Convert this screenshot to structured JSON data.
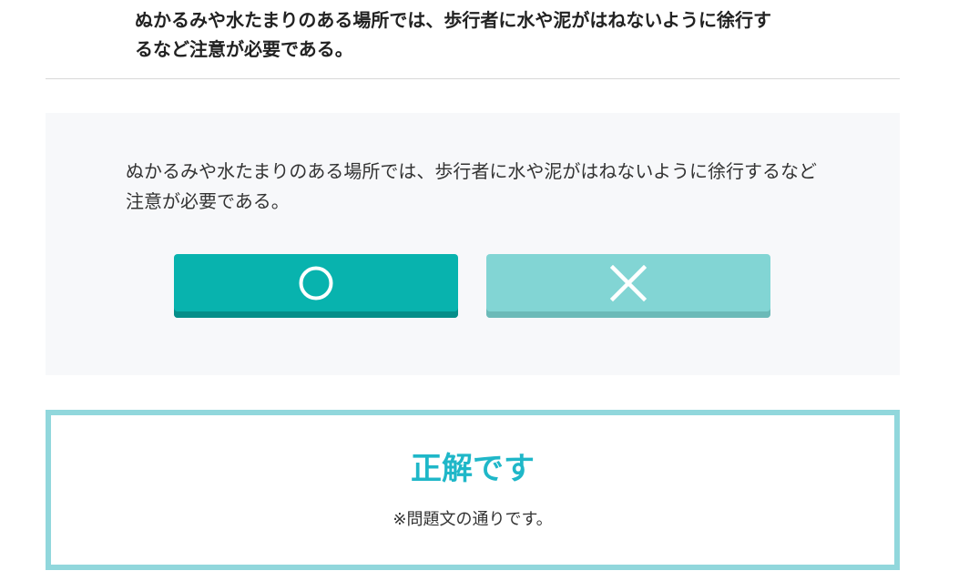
{
  "header": {
    "title": "ぬかるみや水たまりのある場所では、歩行者に水や泥がはねないように徐行するなど注意が必要である。"
  },
  "quiz": {
    "question": "ぬかるみや水たまりのある場所では、歩行者に水や泥がはねないように徐行するなど注意が必要である。",
    "answers": [
      {
        "symbol": "circle-icon",
        "color": "#08b3ae"
      },
      {
        "symbol": "cross-icon",
        "color": "#82d5d4"
      }
    ]
  },
  "result": {
    "title": "正解です",
    "note": "※問題文の通りです。",
    "title_color": "#1fb7c8",
    "border_color": "#91d7dc"
  }
}
